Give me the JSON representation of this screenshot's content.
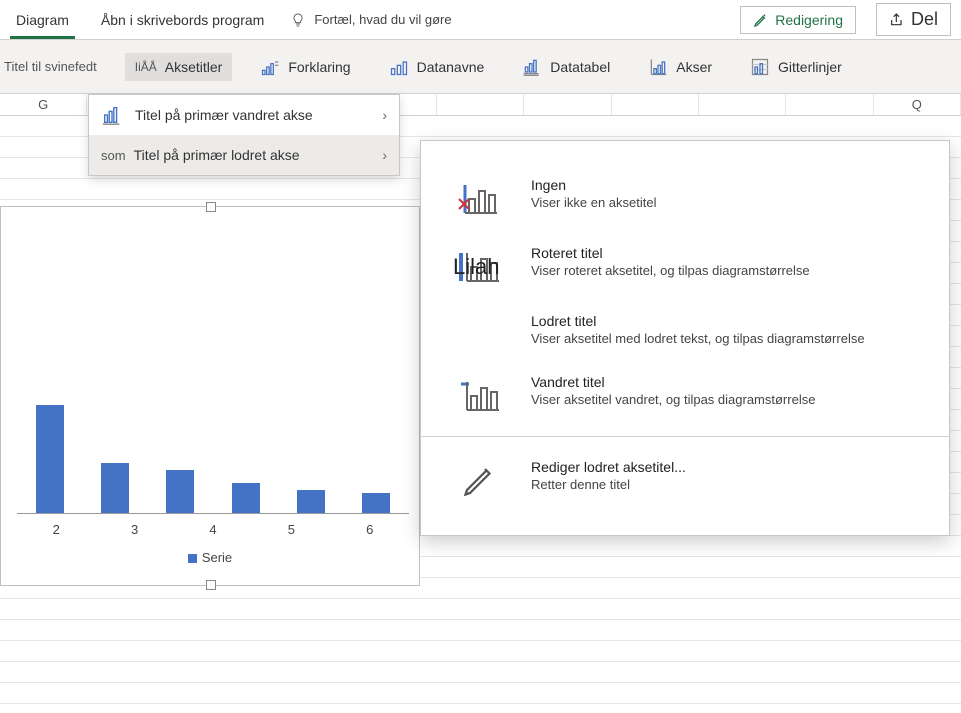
{
  "tabs": {
    "diagram": "Diagram",
    "open_desktop": "Åbn i skrivebords program"
  },
  "tellme": "Fortæl, hvad du vil gøre",
  "buttons": {
    "edit": "Redigering",
    "share": "Del"
  },
  "ribbon": {
    "titel_svinefedt": "Titel til svinefedt",
    "aksetitler_pref": "IiÅÅ",
    "aksetitler": "Aksetitler",
    "forklaring": "Forklaring",
    "datanavne": "Datanavne",
    "datatabel": "Datatabel",
    "akser": "Akser",
    "gitterlinjer": "Gitterlinjer"
  },
  "columns": [
    "G",
    "",
    "",
    "",
    "",
    "",
    "",
    "",
    "",
    "",
    "Q"
  ],
  "submenu": {
    "horizontal": "Titel på primær vandret akse",
    "vertical_pref": "som",
    "vertical": "Titel på primær lodret akse"
  },
  "flyout": {
    "none_t": "Ingen",
    "none_d": "Viser ikke en aksetitel",
    "rot_t": "Roteret titel",
    "rot_d": "Viser roteret aksetitel, og tilpas diagramstørrelse",
    "vert_t": "Lodret titel",
    "vert_d": "Viser aksetitel med lodret tekst, og tilpas diagramstørrelse",
    "horiz_t": "Vandret titel",
    "horiz_d": "Viser aksetitel vandret, og tilpas diagramstørrelse",
    "edit_t": "Rediger lodret aksetitel...",
    "edit_d": "Retter denne titel"
  },
  "watermark": "Lilah",
  "chart_data": {
    "type": "bar",
    "categories": [
      "2",
      "3",
      "4",
      "5",
      "6"
    ],
    "values": [
      130,
      60,
      52,
      36,
      28,
      24
    ],
    "legend": "Serie",
    "title": "",
    "xlabel": "",
    "ylabel": "",
    "ylim": [
      0,
      140
    ]
  }
}
